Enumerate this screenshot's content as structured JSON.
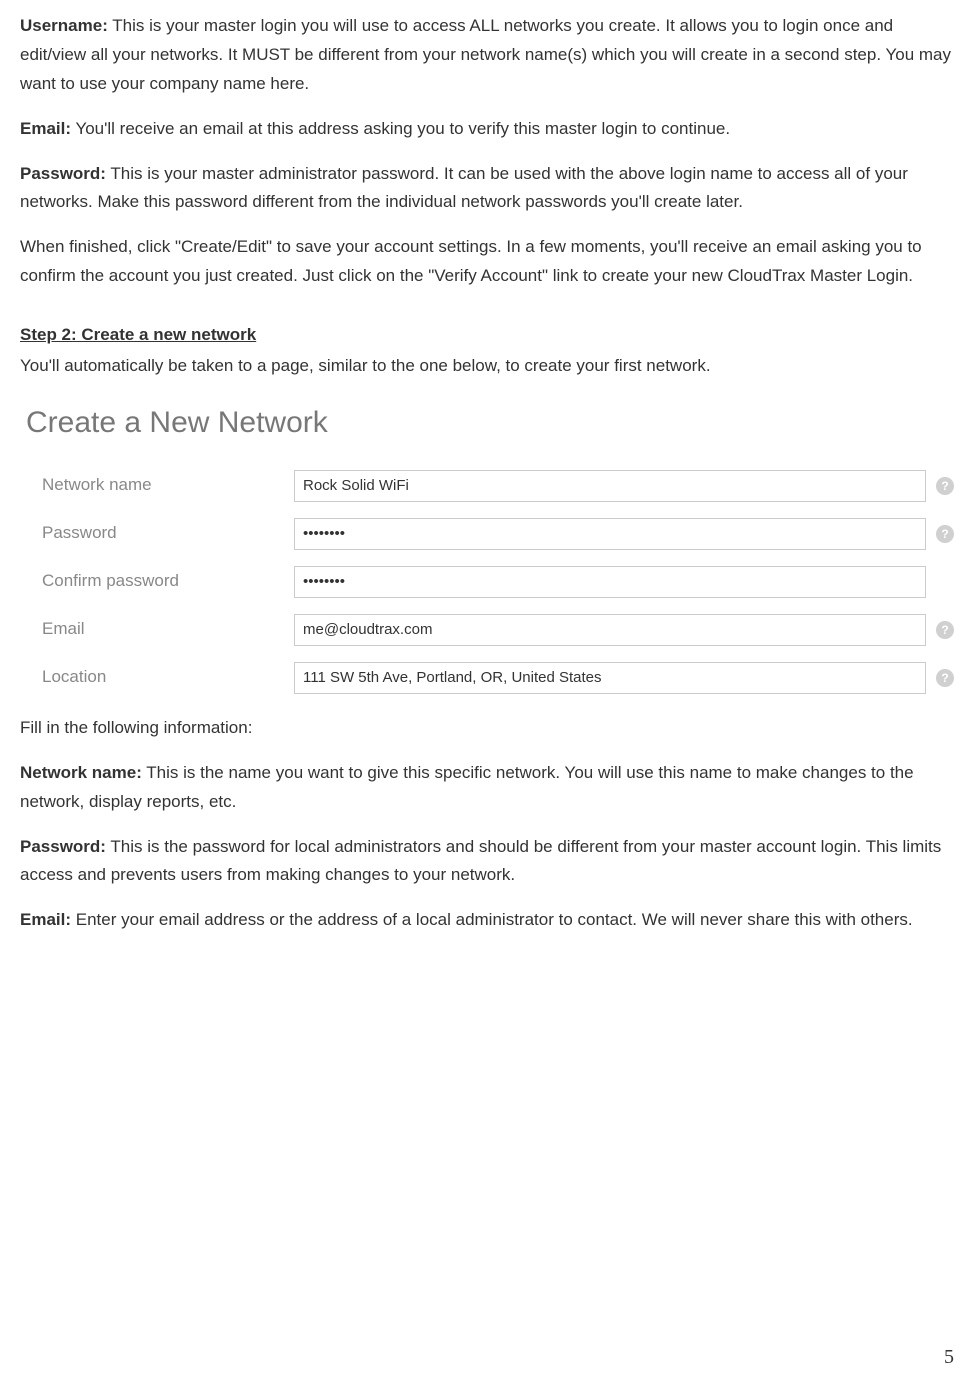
{
  "paragraphs": {
    "username_label": "Username:",
    "username_text": " This is your master login you will use to access ALL networks you create. It allows you to login once and edit/view all your networks. It MUST be different from your network name(s) which you will create in a second step. You may want to use your company name here.",
    "email1_label": "Email:",
    "email1_text": " You'll receive an email at this address asking you to verify this master login to continue.",
    "password1_label": "Password:",
    "password1_text": " This is your master administrator password. It can be used with the above login name to access all of your networks. Make this password different from the individual network passwords you'll create later.",
    "finished_text": "When finished, click \"Create/Edit\" to save your account settings. In a few moments, you'll receive an email asking you to confirm the account you just created. Just click on the \"Verify Account\" link to create your new CloudTrax Master Login.",
    "step2_heading": "Step 2: Create a new network",
    "step2_intro": "You'll automatically be taken to a page, similar to the one below, to create your first network.",
    "fill_info": "Fill in the following information:",
    "netname_label": "Network name:",
    "netname_text": " This is the name you want to give this specific network. You will use this name to make changes to the network, display reports, etc.",
    "password2_label": "Password:",
    "password2_text": " This is the password for local administrators and should be different from your master account login. This limits access and prevents users from making changes to your network.",
    "email2_label": "Email:",
    "email2_text": " Enter your email address or the address of a local administrator to contact. We will never share this with others."
  },
  "form": {
    "title": "Create a New Network",
    "rows": {
      "network_name": {
        "label": "Network name",
        "value": "Rock Solid WiFi"
      },
      "password": {
        "label": "Password",
        "value": "••••••••"
      },
      "confirm": {
        "label": "Confirm password",
        "value": "••••••••"
      },
      "email": {
        "label": "Email",
        "value": "me@cloudtrax.com"
      },
      "location": {
        "label": "Location",
        "value": "111 SW 5th Ave, Portland, OR, United States"
      }
    },
    "help_glyph": "?"
  },
  "page_number": "5"
}
